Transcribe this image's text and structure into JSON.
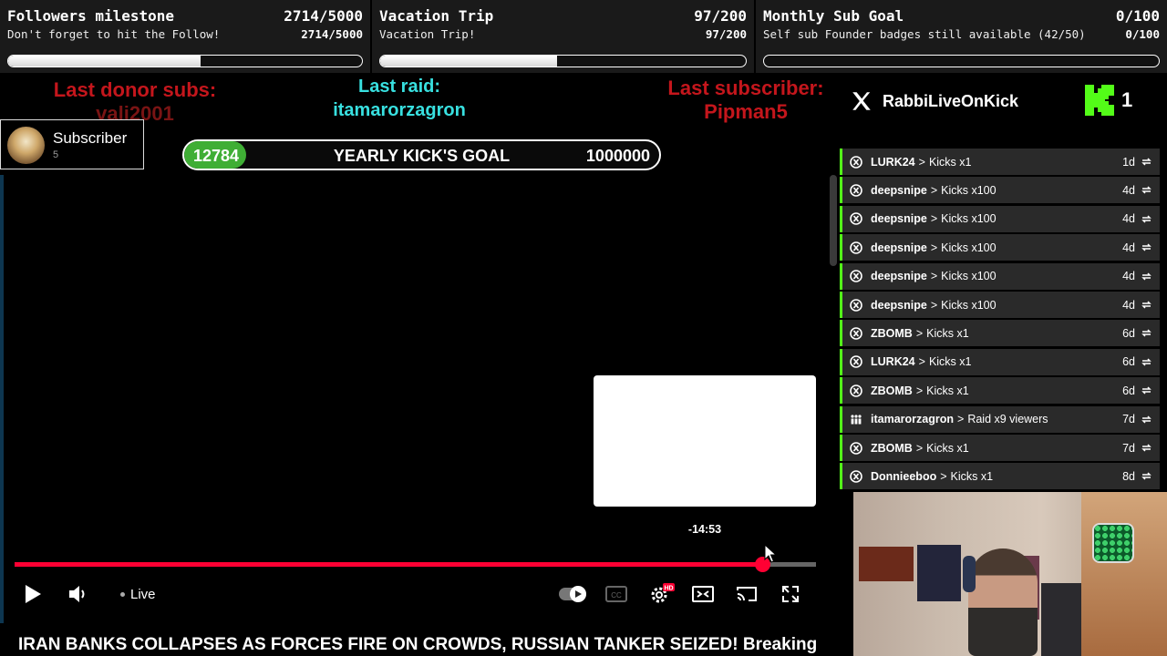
{
  "goals": [
    {
      "title": "Followers milestone",
      "subtitle": "Don't forget to hit the Follow!",
      "count": "2714/5000",
      "count_small": "2714/5000",
      "progress": 0.543
    },
    {
      "title": "Vacation Trip",
      "subtitle": "Vacation Trip!",
      "count": "97/200",
      "count_small": "97/200",
      "progress": 0.485
    },
    {
      "title": "Monthly Sub Goal",
      "subtitle": "Self sub Founder badges still available (42/50)",
      "count": "0/100",
      "count_small": "0/100",
      "progress": 0
    }
  ],
  "last_donor": {
    "label": "Last donor subs:",
    "name": "vali2001"
  },
  "last_raid": {
    "label": "Last raid:",
    "name": "itamarorzagron"
  },
  "last_subscriber": {
    "label": "Last subscriber:",
    "name": "Pipman5"
  },
  "subscriber_card": {
    "label": "Subscriber",
    "count": "5"
  },
  "yearly_goal": {
    "current": "12784",
    "label": "YEARLY KICK'S GOAL",
    "target": "1000000"
  },
  "x_account": {
    "handle": "RabbiLiveOnKick",
    "icon": "x-logo-icon"
  },
  "kick": {
    "count": "1",
    "icon": "kick-logo-icon",
    "color": "#53fc18"
  },
  "events": [
    {
      "user": "LURK24",
      "action": "Kicks x1",
      "time": "1d",
      "icon": "kick-circle-icon"
    },
    {
      "user": "deepsnipe",
      "action": "Kicks x100",
      "time": "4d",
      "icon": "kick-circle-icon"
    },
    {
      "user": "deepsnipe",
      "action": "Kicks x100",
      "time": "4d",
      "icon": "kick-circle-icon"
    },
    {
      "user": "deepsnipe",
      "action": "Kicks x100",
      "time": "4d",
      "icon": "kick-circle-icon"
    },
    {
      "user": "deepsnipe",
      "action": "Kicks x100",
      "time": "4d",
      "icon": "kick-circle-icon"
    },
    {
      "user": "deepsnipe",
      "action": "Kicks x100",
      "time": "4d",
      "icon": "kick-circle-icon"
    },
    {
      "user": "ZBOMB",
      "action": "Kicks x1",
      "time": "6d",
      "icon": "kick-circle-icon"
    },
    {
      "user": "LURK24",
      "action": "Kicks x1",
      "time": "6d",
      "icon": "kick-circle-icon"
    },
    {
      "user": "ZBOMB",
      "action": "Kicks x1",
      "time": "6d",
      "icon": "kick-circle-icon"
    },
    {
      "user": "itamarorzagron",
      "action": "Raid x9 viewers",
      "time": "7d",
      "icon": "raid-icon"
    },
    {
      "user": "ZBOMB",
      "action": "Kicks x1",
      "time": "7d",
      "icon": "kick-circle-icon"
    },
    {
      "user": "Donnieeboo",
      "action": "Kicks x1",
      "time": "8d",
      "icon": "kick-circle-icon"
    }
  ],
  "event_separator": ">",
  "player": {
    "time_tooltip": "-14:53",
    "progress": 0.933,
    "live_label": "Live",
    "hd_badge": "HD",
    "title": "IRAN BANKS COLLAPSES AS FORCES FIRE ON CROWDS, RUSSIAN TANKER SEIZED! Breaking",
    "played_color": "#ff0033"
  }
}
